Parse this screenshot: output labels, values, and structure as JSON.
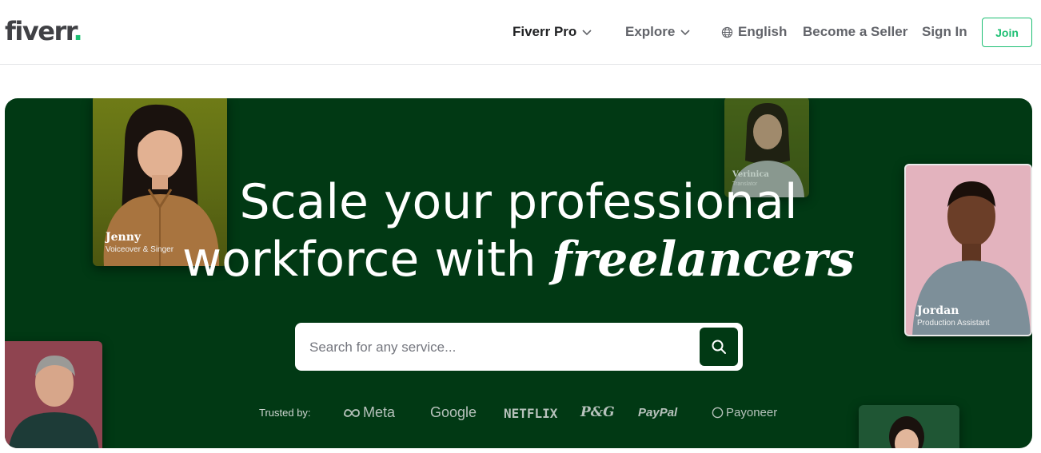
{
  "header": {
    "logo_text": "fiverr",
    "logo_dot": ".",
    "nav": {
      "fiverr_pro": "Fiverr Pro",
      "explore": "Explore",
      "language": "English",
      "become_seller": "Become a Seller",
      "sign_in": "Sign In",
      "join": "Join"
    }
  },
  "hero": {
    "headline_line1": "Scale your professional",
    "headline_line2_plain": "workforce with ",
    "headline_line2_italic": "freelancers",
    "search": {
      "placeholder": "Search for any service..."
    },
    "trusted": {
      "label": "Trusted by:",
      "brands": [
        "Meta",
        "Google",
        "NETFLIX",
        "P&G",
        "PayPal",
        "Payoneer"
      ]
    },
    "cards": {
      "jenny": {
        "name": "Jenny",
        "role": "Voiceover & Singer"
      },
      "verinica": {
        "name": "Verinica",
        "role": "Translator"
      },
      "jordan": {
        "name": "Jordan",
        "role": "Production Assistant"
      }
    }
  },
  "colors": {
    "brand_green": "#1dbf73",
    "hero_bg": "#013914"
  }
}
